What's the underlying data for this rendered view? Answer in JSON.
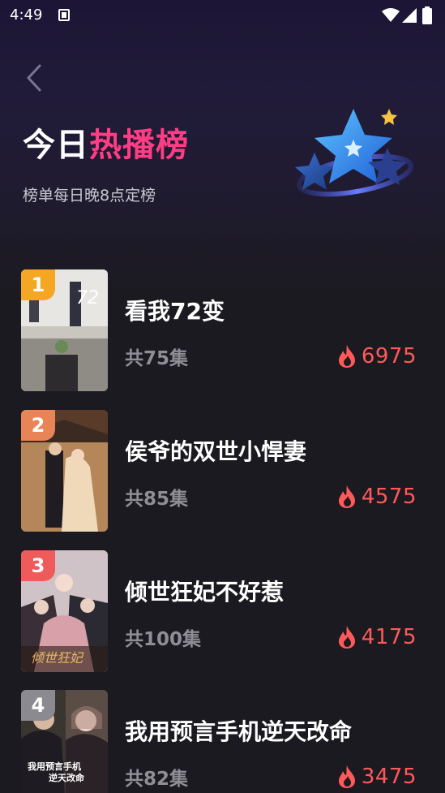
{
  "status_bar": {
    "time": "4:49",
    "icons": [
      "app-notification-icon",
      "wifi-icon",
      "signal-icon",
      "battery-icon"
    ]
  },
  "header": {
    "back_icon": "chevron-left-icon",
    "title_prefix": "今日",
    "title_highlight": "热播榜",
    "subtitle": "榜单每日晚8点定榜",
    "illustration": "stars-icon"
  },
  "colors": {
    "accent_pink": "#ff3d84",
    "heat_red": "#ff5a5a",
    "rank_1": "#f5a623",
    "rank_2": "#e98457",
    "rank_3": "#ef5b5b",
    "rank_other": "#8a8a90"
  },
  "ranking": [
    {
      "rank": "1",
      "title": "看我72变",
      "episodes": "共75集",
      "heat": "6975",
      "cover_icon": "poster-image"
    },
    {
      "rank": "2",
      "title": "侯爷的双世小悍妻",
      "episodes": "共85集",
      "heat": "4575",
      "cover_icon": "poster-image"
    },
    {
      "rank": "3",
      "title": "倾世狂妃不好惹",
      "episodes": "共100集",
      "heat": "4175",
      "cover_icon": "poster-image"
    },
    {
      "rank": "4",
      "title": "我用预言手机逆天改命",
      "episodes": "共82集",
      "heat": "3475",
      "cover_icon": "poster-image"
    }
  ]
}
